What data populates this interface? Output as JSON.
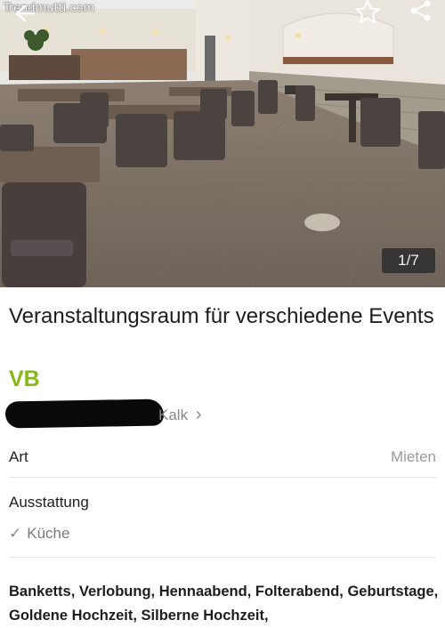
{
  "watermark": "Trendmutti.com",
  "photo": {
    "counter": "1/7"
  },
  "listing": {
    "title": "Veranstaltungsraum für verschiedene Events",
    "price": "VB",
    "location": "Kalk",
    "location_chevron": "›"
  },
  "details": {
    "type_label": "Art",
    "type_value": "Mieten",
    "equipment_label": "Ausstattung",
    "equipment_items": [
      "Küche"
    ]
  },
  "description": "Banketts, Verlobung, Hennaabend, Folterabend, Geburtstage, Goldene Hochzeit, Silberne Hochzeit,",
  "icons": {
    "favorite": "star-icon",
    "share": "share-icon",
    "back": "back-arrow-icon",
    "check": "check-icon"
  },
  "colors": {
    "price": "#86b817",
    "counter_bg": "#2d2d2d"
  }
}
